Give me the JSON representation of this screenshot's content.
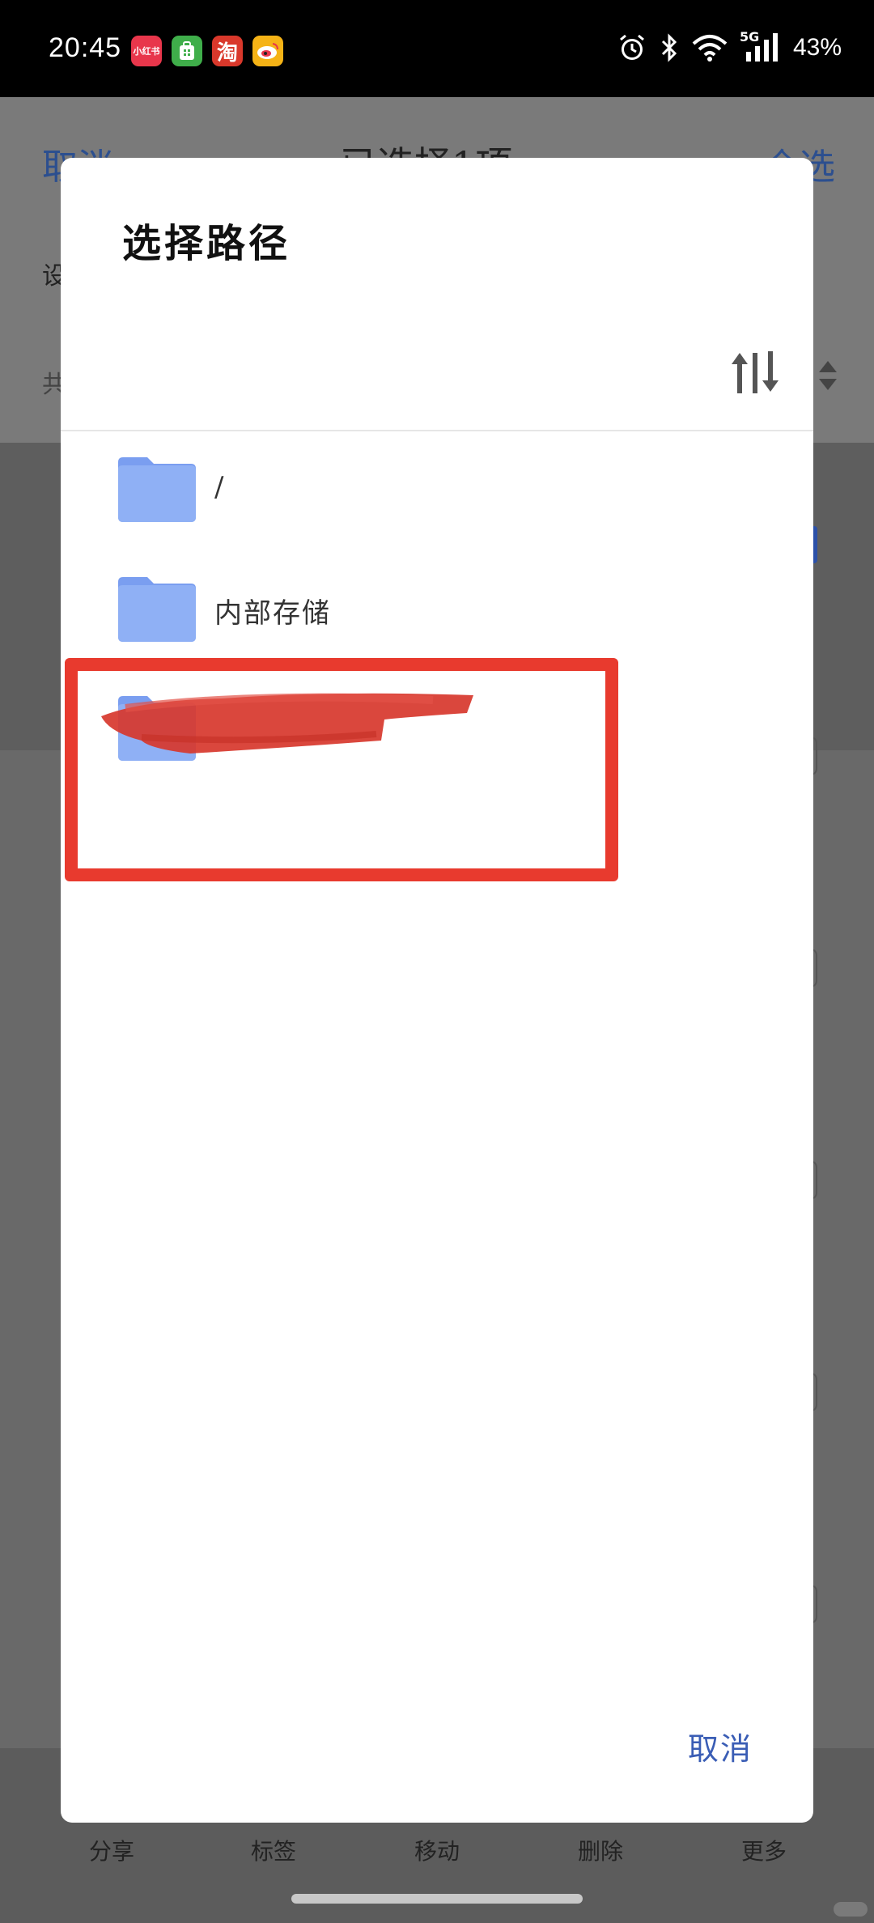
{
  "status_bar": {
    "time": "20:45",
    "apps": [
      {
        "name": "xiaohongshu-icon",
        "text": "小红书"
      },
      {
        "name": "green-app-icon",
        "text": ""
      },
      {
        "name": "taobao-icon",
        "text": "淘"
      },
      {
        "name": "weibo-icon",
        "text": ""
      }
    ],
    "battery": "43%",
    "network": "5G",
    "icons": [
      "alarm-icon",
      "bluetooth-icon",
      "wifi-icon",
      "signal-icon"
    ]
  },
  "background_page": {
    "cancel_label": "取消",
    "title": "已选择1项",
    "select_all_label": "全选",
    "row1_text": "设",
    "row2_text": "共"
  },
  "dialog": {
    "title": "选择路径",
    "folders": [
      {
        "label": "/"
      },
      {
        "label": "内部存储"
      },
      {
        "label": ""
      }
    ],
    "cancel_label": "取消",
    "colors": {
      "folder": "#8fb0f5",
      "folder_tab": "#7a9ef0",
      "accent": "#3a5db5",
      "highlight": "#e83a2e"
    }
  },
  "bottom_nav": [
    {
      "label": "分享"
    },
    {
      "label": "标签"
    },
    {
      "label": "移动"
    },
    {
      "label": "删除"
    },
    {
      "label": "更多"
    }
  ]
}
